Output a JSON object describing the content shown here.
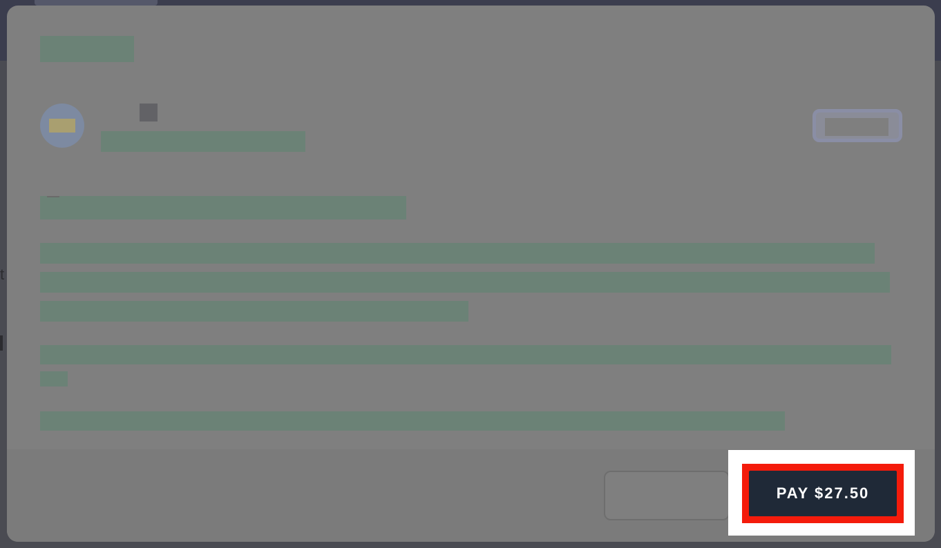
{
  "colors": {
    "modal_background": "#7f7f7f",
    "redacted_block": "#6b8276",
    "pay_button_background": "#1f2937",
    "pay_button_text": "#ffffff",
    "highlight_border": "#f41b0b",
    "highlight_panel": "#ffffff"
  },
  "background": {
    "partial_char": "t"
  },
  "modal": {
    "footer": {
      "pay_label": "PAY $27.50"
    }
  }
}
